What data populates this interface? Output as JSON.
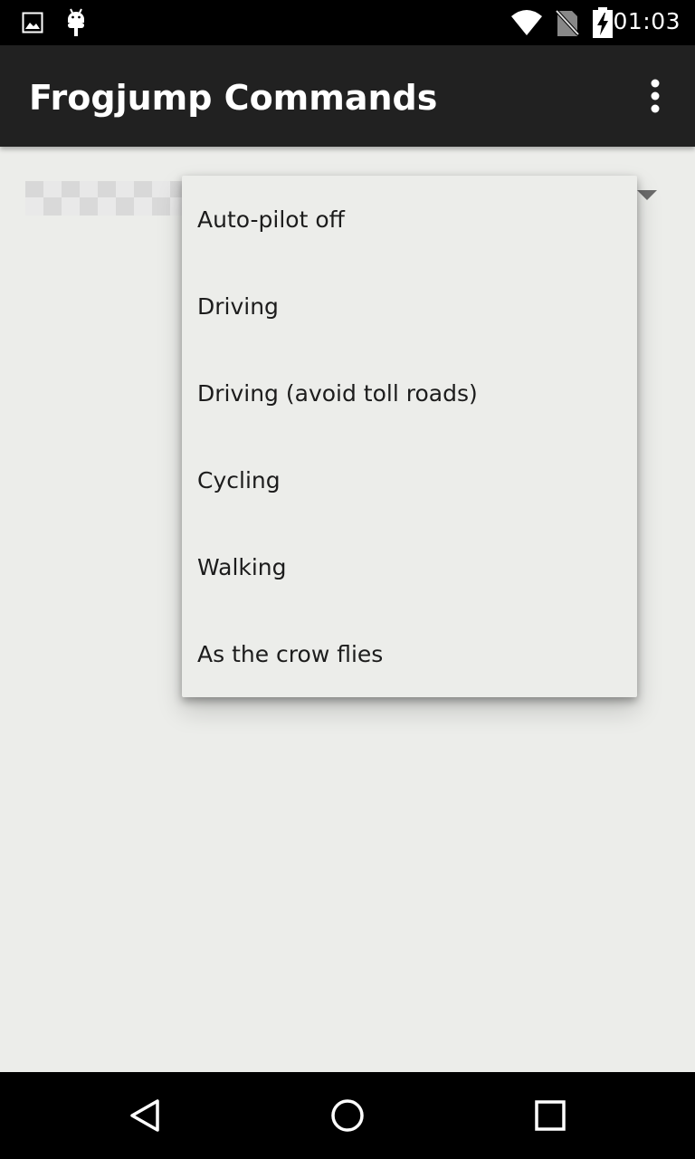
{
  "status_bar": {
    "time": "01:03",
    "icons": [
      "image-notification-icon",
      "android-debug-icon",
      "wifi-icon",
      "no-sim-icon",
      "battery-charging-icon"
    ]
  },
  "toolbar": {
    "title": "Frogjump Commands",
    "overflow_icon": "more-vert-icon"
  },
  "spinner": {
    "selected_value_obscured": true,
    "arrow_icon": "dropdown-arrow-icon"
  },
  "dropdown": {
    "options": [
      "Auto-pilot off",
      "Driving",
      "Driving (avoid toll roads)",
      "Cycling",
      "Walking",
      "As the crow flies"
    ]
  },
  "nav_bar": {
    "buttons": [
      "back-icon",
      "home-icon",
      "recents-icon"
    ]
  },
  "colors": {
    "status_bar": "#000000",
    "toolbar": "#212121",
    "background": "#ecedea",
    "text": "#1c1c1c"
  }
}
